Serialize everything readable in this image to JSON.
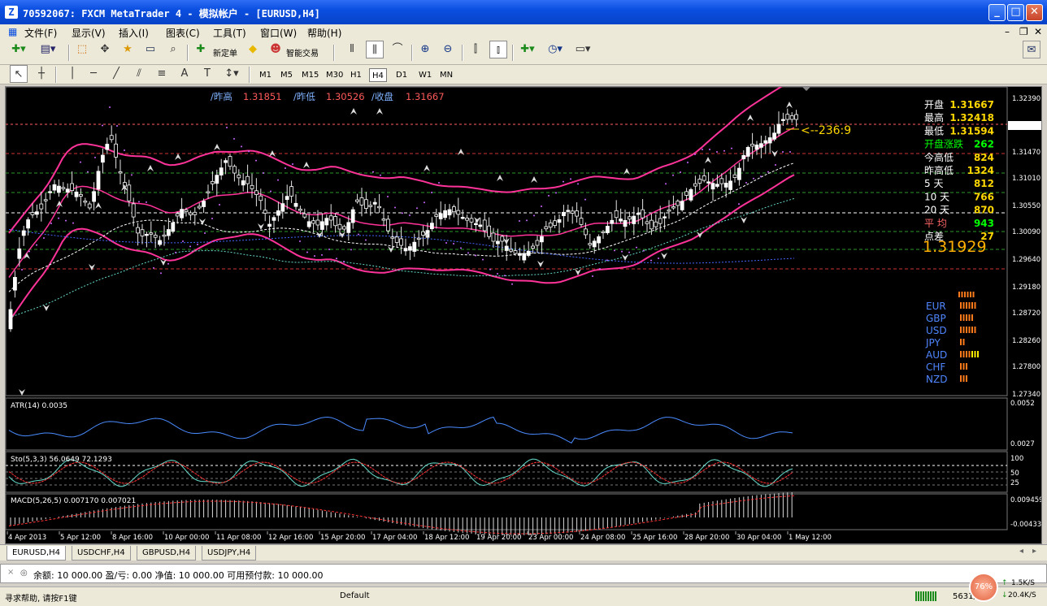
{
  "window": {
    "title": "70592067: FXCM MetaTrader 4 - 模拟帐户 - [EURUSD,H4]"
  },
  "menu": [
    "文件(F)",
    "显示(V)",
    "插入(I)",
    "图表(C)",
    "工具(T)",
    "窗口(W)",
    "帮助(H)"
  ],
  "toolbar": {
    "new_order": "新定单",
    "expert": "智能交易"
  },
  "timeframes": [
    "M1",
    "M5",
    "M15",
    "M30",
    "H1",
    "H4",
    "D1",
    "W1",
    "MN"
  ],
  "active_timeframe": "H4",
  "chart": {
    "header": {
      "high_label": "/昨高",
      "high": "1.31851",
      "low_label": "/昨低",
      "low": "1.30526",
      "close_label": "/收盘",
      "close": "1.31667"
    },
    "price_axis": [
      "1.32390",
      "1.31929",
      "1.31470",
      "1.31010",
      "1.30550",
      "1.30090",
      "1.29640",
      "1.29180",
      "1.28720",
      "1.28260",
      "1.27800",
      "1.27340"
    ],
    "current_price": "1.31929",
    "arrow_label": "<--236:9",
    "panel": {
      "rows": [
        {
          "label": "开盘",
          "value": "1.31667"
        },
        {
          "label": "最高",
          "value": "1.32418"
        },
        {
          "label": "最低",
          "value": "1.31594"
        },
        {
          "label": "开盘涨跌",
          "value": "262"
        },
        {
          "label": "今高低",
          "value": "824"
        },
        {
          "label": "昨高低",
          "value": "1324"
        },
        {
          "label": "5  天",
          "value": "812"
        },
        {
          "label": "10 天",
          "value": "766"
        },
        {
          "label": "20 天",
          "value": "870"
        },
        {
          "label": "平  均",
          "value": "943"
        },
        {
          "label": "点差",
          "value": "27"
        }
      ],
      "big_price": "1.31929",
      "currencies": [
        "EUR",
        "GBP",
        "USD",
        "JPY",
        "AUD",
        "CHF",
        "NZD"
      ],
      "currency_bars": [
        6,
        5,
        6,
        2,
        7,
        3,
        3
      ]
    },
    "atr": {
      "label": "ATR(14) 0.0035",
      "axis": [
        "0.0052",
        "0.0027"
      ]
    },
    "sto": {
      "label": "Sto(5,3,3) 56.0649 72.1293",
      "axis": [
        "100",
        "50",
        "25"
      ]
    },
    "macd": {
      "label": "MACD(5,26,5) 0.007170 0.007021",
      "axis": [
        "0.009459",
        "-0.004337"
      ]
    },
    "time_axis": [
      "4 Apr 2013",
      "5 Apr 12:00",
      "8 Apr 16:00",
      "10 Apr 00:00",
      "11 Apr 08:00",
      "12 Apr 16:00",
      "15 Apr 20:00",
      "17 Apr 04:00",
      "18 Apr 12:00",
      "19 Apr 20:00",
      "23 Apr 00:00",
      "24 Apr 08:00",
      "25 Apr 16:00",
      "28 Apr 20:00",
      "30 Apr 04:00",
      "1 May 12:00"
    ]
  },
  "tabs": [
    "EURUSD,H4",
    "USDCHF,H4",
    "GBPUSD,H4",
    "USDJPY,H4"
  ],
  "account": {
    "text": "余额: 10 000.00  盈/亏: 0.00  净值: 10 000.00  可用预付款: 10 000.00"
  },
  "status": {
    "help": "寻求帮助, 请按F1键",
    "profile": "Default",
    "conn": "5631/1",
    "cpu": "76%",
    "up": "1.5K/S",
    "down": "20.4K/S"
  },
  "colors": {
    "up": "#ffffff",
    "bands": "#ff3399",
    "bg": "#000000"
  }
}
